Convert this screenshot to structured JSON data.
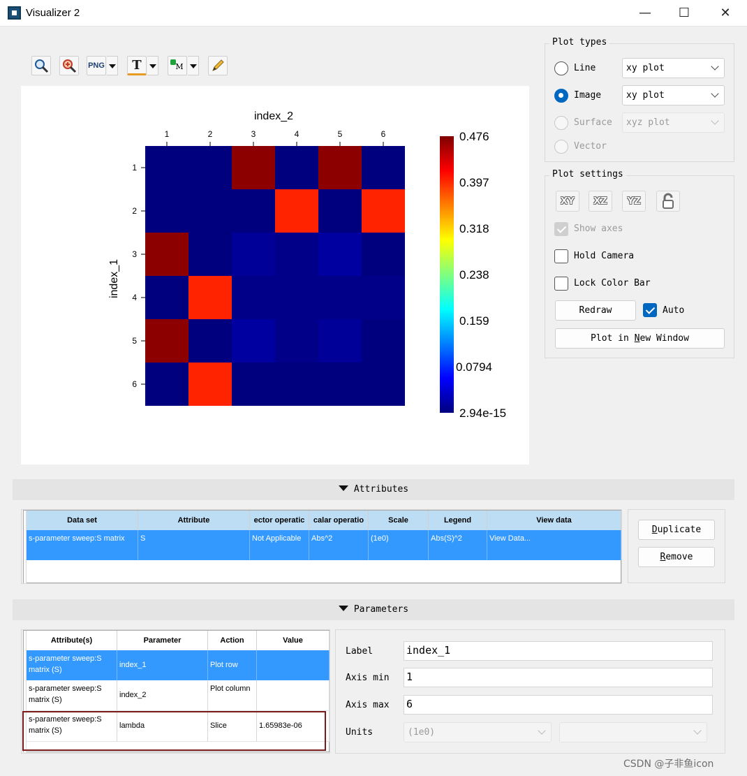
{
  "window": {
    "title": "Visualizer 2",
    "minimize": "—",
    "maximize": "☐",
    "close": "✕"
  },
  "toolbar": {
    "zoom": "zoom-icon",
    "reset_zoom": "reset-zoom-icon",
    "png_label": "PNG",
    "text_label": "T",
    "marker_label": "M",
    "edit": "pencil-icon"
  },
  "chart_data": {
    "type": "heatmap",
    "title": "index_2",
    "xlabel": "index_2",
    "ylabel": "index_1",
    "x": [
      1,
      2,
      3,
      4,
      5,
      6
    ],
    "y": [
      1,
      2,
      3,
      4,
      5,
      6
    ],
    "x_ticks": [
      "1",
      "2",
      "3",
      "4",
      "5",
      "6"
    ],
    "y_ticks": [
      "1",
      "2",
      "3",
      "4",
      "5",
      "6"
    ],
    "colorscale": "jet",
    "zlim": [
      0,
      0.476
    ],
    "colorbar_ticks": [
      "0.476",
      "0.397",
      "0.318",
      "0.238",
      "0.159",
      "0.0794",
      "2.94e-15"
    ],
    "z": [
      [
        0.0,
        0.0,
        0.47,
        0.0,
        0.47,
        0.0
      ],
      [
        0.0,
        0.0,
        0.0,
        0.4,
        0.0,
        0.4
      ],
      [
        0.47,
        0.0,
        0.012,
        0.004,
        0.016,
        0.0
      ],
      [
        0.0,
        0.4,
        0.004,
        0.004,
        0.004,
        0.004
      ],
      [
        0.47,
        0.0,
        0.016,
        0.004,
        0.012,
        0.0
      ],
      [
        0.0,
        0.4,
        0.0,
        0.0,
        0.0,
        0.0
      ]
    ]
  },
  "plot_types": {
    "title": "Plot types",
    "items": [
      {
        "label": "Line",
        "selected": false,
        "disabled": false,
        "combo": "xy plot"
      },
      {
        "label": "Image",
        "selected": true,
        "disabled": false,
        "combo": "xy plot"
      },
      {
        "label": "Surface",
        "selected": false,
        "disabled": true,
        "combo": "xyz plot"
      },
      {
        "label": "Vector",
        "selected": false,
        "disabled": true,
        "combo": ""
      }
    ]
  },
  "plot_settings": {
    "title": "Plot settings",
    "view_buttons": [
      "XY",
      "XZ",
      "YZ",
      "lock-view-icon"
    ],
    "show_axes": "Show axes",
    "hold_camera": "Hold Camera",
    "lock_color_bar": "Lock Color Bar",
    "redraw": "Redraw",
    "auto": "Auto",
    "plot_new_window_pre": "Plot in ",
    "plot_new_window_u": "N",
    "plot_new_window_post": "ew Window"
  },
  "attributes": {
    "section": "Attributes",
    "headers": [
      "Data set",
      "Attribute",
      "ector operatic",
      "calar operatio",
      "Scale",
      "Legend",
      "View data"
    ],
    "row": [
      "s-parameter sweep:S matrix",
      "S",
      "Not Applicable",
      "Abs^2",
      "(1e0)",
      "Abs(S)^2",
      "View Data..."
    ],
    "duplicate_u": "D",
    "duplicate_rest": "uplicate",
    "remove_u": "R",
    "remove_rest": "emove"
  },
  "parameters": {
    "section": "Parameters",
    "headers": [
      "Attribute(s)",
      "Parameter",
      "Action",
      "Value"
    ],
    "rows": [
      [
        "s-parameter sweep:S matrix (S)",
        "index_1",
        "Plot row",
        ""
      ],
      [
        "s-parameter sweep:S matrix (S)",
        "index_2",
        "Plot column",
        ""
      ],
      [
        "s-parameter sweep:S matrix (S)",
        "lambda",
        "Slice",
        "1.65983e-06"
      ]
    ],
    "label_label": "Label",
    "label_value": "index_1",
    "axis_min_label": "Axis min",
    "axis_min_value": "1",
    "axis_max_label": "Axis max",
    "axis_max_value": "6",
    "units_label": "Units",
    "units_value": "(1e0)"
  },
  "watermark": "CSDN @子非鱼icon"
}
